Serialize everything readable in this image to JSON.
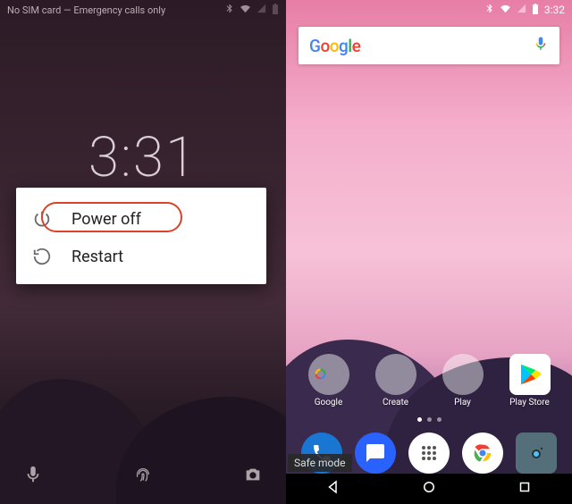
{
  "left": {
    "status_text": "No SIM card — Emergency calls only",
    "clock": "3:31",
    "power_menu": {
      "power_off": "Power off",
      "restart": "Restart"
    }
  },
  "right": {
    "clock": "3:32",
    "search_brand": "Google",
    "apps": [
      {
        "label": "Google"
      },
      {
        "label": "Create"
      },
      {
        "label": "Play"
      },
      {
        "label": "Play Store"
      }
    ],
    "safe_mode_badge": "Safe mode"
  }
}
